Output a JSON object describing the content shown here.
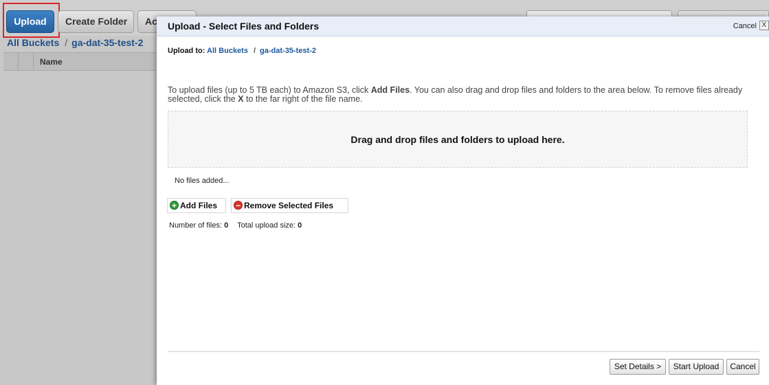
{
  "toolbar": {
    "upload_label": "Upload",
    "create_folder_label": "Create Folder",
    "actions_label": "Actions"
  },
  "breadcrumb": {
    "root": "All Buckets",
    "separator": "/",
    "bucket": "ga-dat-35-test-2"
  },
  "table": {
    "columns": [
      "Name"
    ]
  },
  "modal": {
    "title": "Upload - Select Files and Folders",
    "cancel_link": "Cancel",
    "close_label": "X",
    "upload_to_label": "Upload to:",
    "upload_to_root": "All Buckets",
    "upload_to_separator": "/",
    "upload_to_bucket": "ga-dat-35-test-2",
    "instructions": {
      "part1": "To upload files (up to 5 TB each) to Amazon S3, click ",
      "add_files": "Add Files",
      "part2": ". You can also drag and drop files and folders to the area below. To remove files already selected, click the ",
      "x": "X",
      "part3": " to the far right of the file name."
    },
    "dropzone_text": "Drag and drop files and folders to upload here.",
    "no_files_text": "No files added...",
    "add_files_button": "Add Files",
    "remove_selected_button": "Remove Selected Files",
    "stats": {
      "num_files_label": "Number of files:",
      "num_files_value": "0",
      "total_size_label": "Total upload size:",
      "total_size_value": "0"
    },
    "footer": {
      "set_details": "Set Details >",
      "start_upload": "Start Upload",
      "cancel": "Cancel"
    }
  },
  "colors": {
    "upload_button": "#2c6db3",
    "highlight_box": "#d9262c",
    "link": "#1e5a9e",
    "modal_header": "#e8eef8",
    "add_icon": "#2e9a34",
    "remove_icon": "#d6362c"
  },
  "icons": {
    "add": "plus-circle-icon",
    "remove": "minus-circle-icon",
    "close": "close-icon"
  }
}
